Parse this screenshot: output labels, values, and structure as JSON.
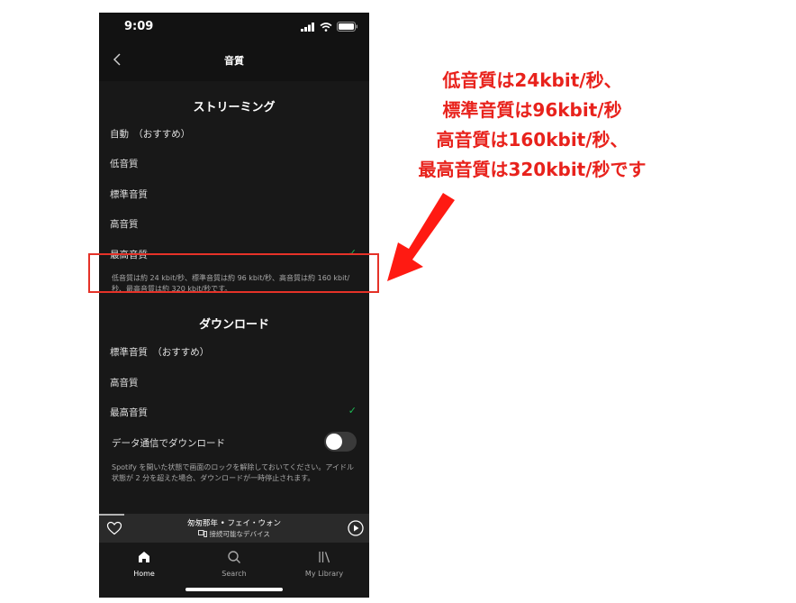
{
  "status_bar": {
    "time": "9:09"
  },
  "header": {
    "title": "音質"
  },
  "streaming": {
    "section_title": "ストリーミング",
    "options": [
      {
        "label": "自動　（おすすめ）",
        "selected": false
      },
      {
        "label": "低音質",
        "selected": false
      },
      {
        "label": "標準音質",
        "selected": false
      },
      {
        "label": "高音質",
        "selected": false
      },
      {
        "label": "最高音質",
        "selected": true
      }
    ],
    "description": "低音質は約 24 kbit/秒、標準音質は約 96 kbit/秒、高音質は約 160 kbit/秒、最高音質は約 320 kbit/秒です。"
  },
  "download": {
    "section_title": "ダウンロード",
    "options": [
      {
        "label": "標準音質　（おすすめ）",
        "selected": false
      },
      {
        "label": "高音質",
        "selected": false
      },
      {
        "label": "最高音質",
        "selected": true
      }
    ],
    "mobile_data_label": "データ通信でダウンロード",
    "mobile_data_enabled": false,
    "description": "Spotify を開いた状態で画面のロックを解除しておいてください。アイドル状態が 2 分を超えた場合、ダウンロードが一時停止されます。"
  },
  "now_playing": {
    "track": "匆匆那年",
    "artist": "フェイ・ウォン",
    "separator": " • ",
    "device": "接続可能なデバイス"
  },
  "tabs": [
    {
      "label": "Home",
      "icon": "home-icon",
      "active": true
    },
    {
      "label": "Search",
      "icon": "search-icon",
      "active": false
    },
    {
      "label": "My Library",
      "icon": "library-icon",
      "active": false
    }
  ],
  "annotation": {
    "lines": [
      "低音質は24kbit/秒、",
      "標準音質は96kbit/秒",
      "高音質は160kbit/秒、",
      "最高音質は320kbit/秒です"
    ],
    "color": "#e8221c"
  },
  "colors": {
    "accent": "#1db954",
    "background": "#121212"
  }
}
